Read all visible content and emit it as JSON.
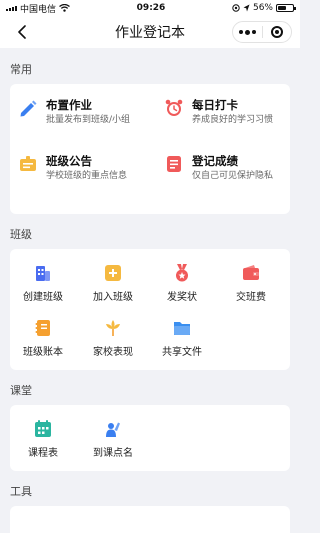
{
  "status_bar": {
    "carrier": "中国电信",
    "time": "09:26",
    "battery": "56%",
    "battery_level": 0.56
  },
  "nav": {
    "title": "作业登记本"
  },
  "sections": {
    "common": {
      "title": "常用",
      "items": [
        {
          "title": "布置作业",
          "desc": "批量发布到班级/小组",
          "icon": "pencil-icon",
          "color": "#3a7ff0"
        },
        {
          "title": "每日打卡",
          "desc": "养成良好的学习习惯",
          "icon": "alarm-clock-icon",
          "color": "#f05a5a"
        },
        {
          "title": "班级公告",
          "desc": "学校班级的重点信息",
          "icon": "notice-board-icon",
          "color": "#f5b940"
        },
        {
          "title": "登记成绩",
          "desc": "仅自己可见保护隐私",
          "icon": "grade-sheet-icon",
          "color": "#f05a5a"
        }
      ]
    },
    "class": {
      "title": "班级",
      "items": [
        {
          "label": "创建班级",
          "icon": "building-icon",
          "color": "#4a6cf0"
        },
        {
          "label": "加入班级",
          "icon": "add-square-icon",
          "color": "#f5b940"
        },
        {
          "label": "发奖状",
          "icon": "medal-icon",
          "color": "#f05a5a"
        },
        {
          "label": "交班费",
          "icon": "wallet-icon",
          "color": "#f05a5a"
        },
        {
          "label": "班级账本",
          "icon": "ledger-icon",
          "color": "#f5a030"
        },
        {
          "label": "家校表现",
          "icon": "flower-icon",
          "color": "#f5b940"
        },
        {
          "label": "共享文件",
          "icon": "folder-icon",
          "color": "#3a8ff0"
        }
      ]
    },
    "classroom": {
      "title": "课堂",
      "items": [
        {
          "label": "课程表",
          "icon": "calendar-icon",
          "color": "#2bb5a0"
        },
        {
          "label": "到课点名",
          "icon": "raise-hand-icon",
          "color": "#3a7ff0"
        }
      ]
    },
    "tools": {
      "title": "工具"
    }
  }
}
